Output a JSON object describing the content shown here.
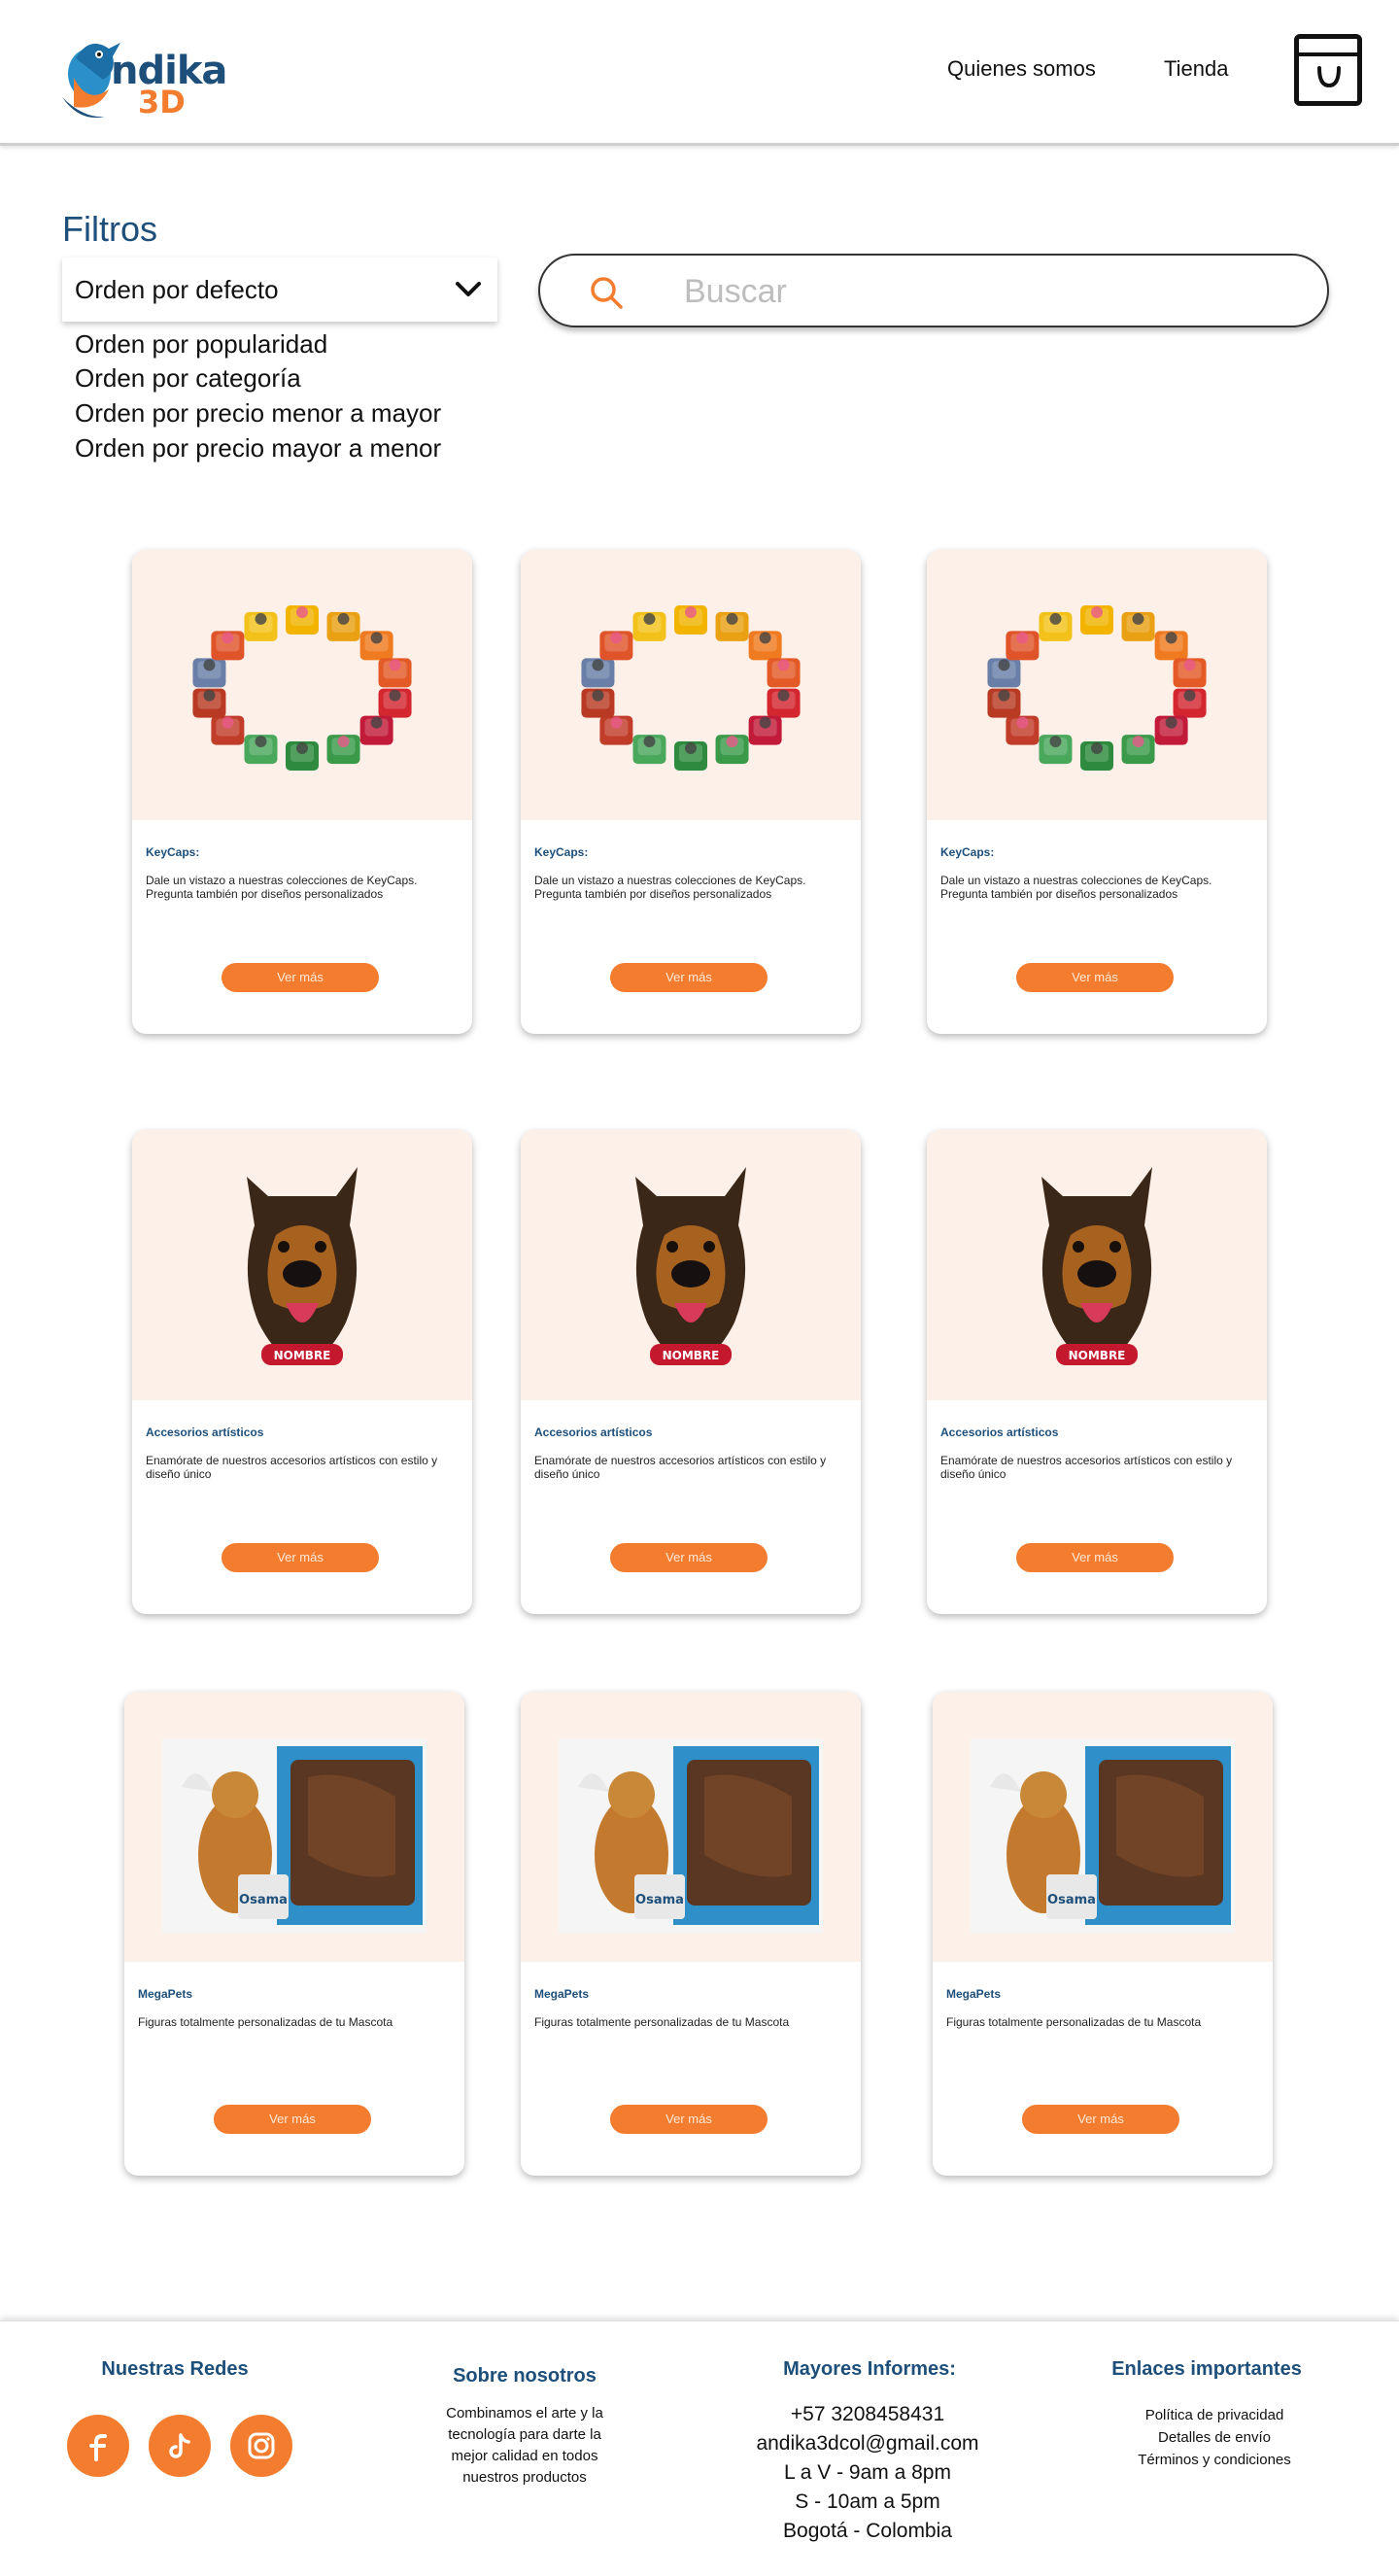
{
  "brand": {
    "name_word": "ndika",
    "name_3d": "3D",
    "colors": {
      "primary": "#1d4f7a",
      "accent": "#f47c2f",
      "card_bg": "#fdf0e8"
    }
  },
  "nav": {
    "about": "Quienes somos",
    "shop": "Tienda",
    "cart_icon": "shopping-bag-icon"
  },
  "filters": {
    "title": "Filtros",
    "selected": "Orden por defecto",
    "options": [
      "Orden por popularidad",
      "Orden por categoría",
      "Orden por precio menor a mayor",
      "Orden por precio mayor a menor"
    ]
  },
  "search": {
    "placeholder": "Buscar",
    "icon": "search-icon"
  },
  "products": [
    {
      "title": "KeyCaps:",
      "desc": "Dale un vistazo a nuestras colecciones de KeyCaps. Pregunta también por diseños personalizados",
      "button": "Ver más",
      "image": "keycaps-image"
    },
    {
      "title": "KeyCaps:",
      "desc": "Dale un vistazo a nuestras colecciones de KeyCaps. Pregunta también por diseños personalizados",
      "button": "Ver más",
      "image": "keycaps-image"
    },
    {
      "title": "KeyCaps:",
      "desc": "Dale un vistazo a nuestras colecciones de KeyCaps. Pregunta también por diseños personalizados",
      "button": "Ver más",
      "image": "keycaps-image"
    },
    {
      "title": "Accesorios artísticos",
      "desc": "Enamórate de nuestros accesorios artísticos con estilo y diseño único",
      "button": "Ver más",
      "image": "dog-keychain-image",
      "badge": "NOMBRE"
    },
    {
      "title": "Accesorios artísticos",
      "desc": "Enamórate de nuestros accesorios artísticos con estilo y diseño único",
      "button": "Ver más",
      "image": "dog-keychain-image",
      "badge": "NOMBRE"
    },
    {
      "title": "Accesorios artísticos",
      "desc": "Enamórate de nuestros accesorios artísticos con estilo y diseño único",
      "button": "Ver más",
      "image": "dog-keychain-image",
      "badge": "NOMBRE"
    },
    {
      "title": "MegaPets",
      "desc": "Figuras totalmente personalizadas de tu Mascota",
      "button": "Ver más",
      "image": "megapets-image",
      "box_label": "Osama"
    },
    {
      "title": "MegaPets",
      "desc": "Figuras totalmente personalizadas de tu Mascota",
      "button": "Ver más",
      "image": "megapets-image",
      "box_label": "Osama"
    },
    {
      "title": "MegaPets",
      "desc": "Figuras totalmente personalizadas de tu Mascota",
      "button": "Ver más",
      "image": "megapets-image",
      "box_label": "Osama"
    }
  ],
  "footer": {
    "social_title": "Nuestras Redes",
    "social_icons": [
      "facebook-icon",
      "tiktok-icon",
      "instagram-icon"
    ],
    "about_title": "Sobre nosotros",
    "about_lines": [
      "Combinamos el arte y la",
      "tecnología para darte la",
      "mejor calidad en todos",
      "nuestros productos"
    ],
    "contact_title": "Mayores Informes:",
    "contact_lines": [
      "+57 3208458431",
      "andika3dcol@gmail.com",
      "L a V - 9am a 8pm",
      "S - 10am a 5pm",
      "Bogotá - Colombia"
    ],
    "links_title": "Enlaces importantes",
    "links": [
      "Política de privacidad",
      "Detalles de envío",
      "Términos y condiciones"
    ]
  }
}
